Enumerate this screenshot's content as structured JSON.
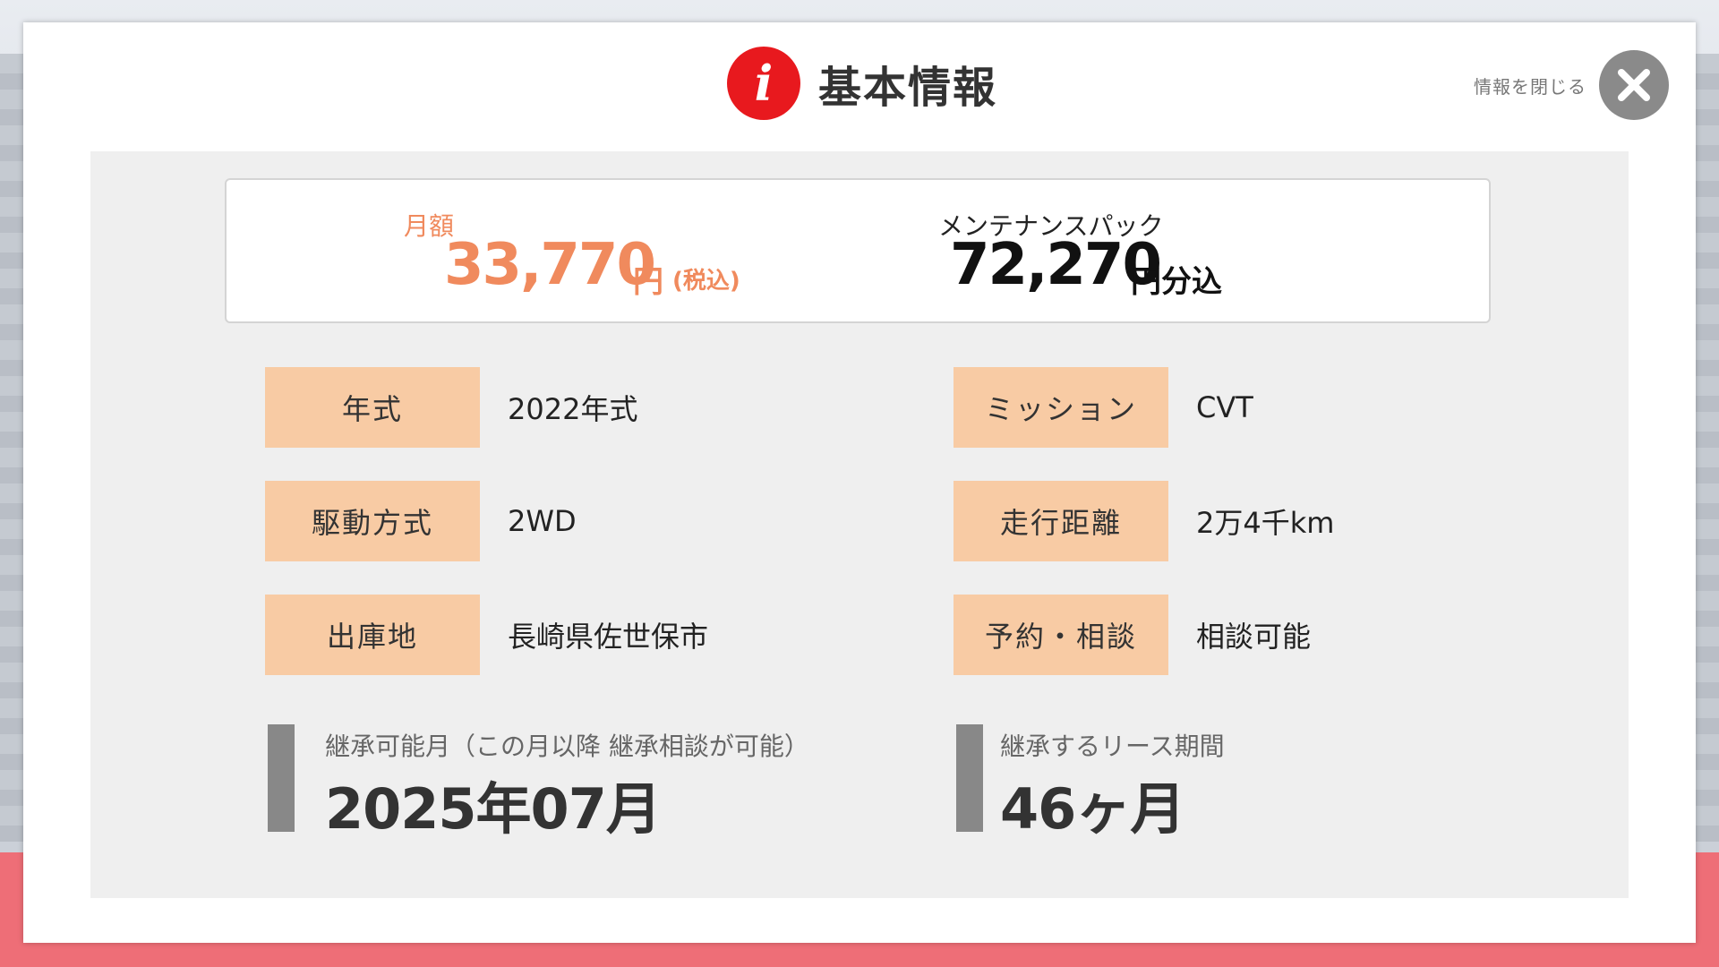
{
  "header": {
    "title": "基本情報",
    "info_icon_glyph": "i",
    "close_label": "情報を閉じる"
  },
  "price": {
    "monthly_label": "月額",
    "monthly_value": "33,770",
    "monthly_unit": "円",
    "monthly_tax": "(税込)",
    "maintenance_label": "メンテナンスパック",
    "maintenance_value": "72,270",
    "maintenance_unit": "円分込"
  },
  "specs": [
    {
      "label": "年式",
      "value": "2022年式"
    },
    {
      "label": "ミッション",
      "value": "CVT"
    },
    {
      "label": "駆動方式",
      "value": "2WD"
    },
    {
      "label": "走行距離",
      "value": "2万4千km"
    },
    {
      "label": "出庫地",
      "value": "長崎県佐世保市"
    },
    {
      "label": "予約・相談",
      "value": "相談可能"
    }
  ],
  "succession": {
    "month_label": "継承可能月（この月以降 継承相談が可能）",
    "month_value": "2025年07月",
    "period_label": "継承するリース期間",
    "period_value": "46ヶ月"
  },
  "colors": {
    "accent_red": "#e8191e",
    "price_orange": "#f08a5d",
    "label_bg": "#f8cba4",
    "panel_bg": "#efefef",
    "bottom_band": "#ee6e77"
  },
  "icons": {
    "info": "info-icon",
    "close": "close-icon"
  }
}
